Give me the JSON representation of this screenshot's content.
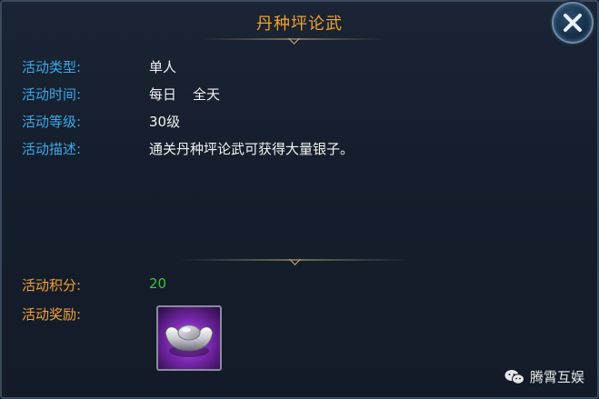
{
  "title": "丹种坪论武",
  "rows": {
    "type": {
      "label": "活动类型:",
      "value": "单人"
    },
    "time": {
      "label": "活动时间:",
      "value_a": "每日",
      "value_b": "全天"
    },
    "level": {
      "label": "活动等级:",
      "value": "30级"
    },
    "desc": {
      "label": "活动描述:",
      "value": "通关丹种坪论武可获得大量银子。"
    }
  },
  "score": {
    "label": "活动积分:",
    "value": "20"
  },
  "reward": {
    "label": "活动奖励:",
    "item_icon": "silver-ingot-icon"
  },
  "close_icon": "close-icon",
  "watermark": {
    "text": "腾霄互娱",
    "icon": "wechat-icon"
  },
  "colors": {
    "title": "#f0a030",
    "label_blue": "#3aa8e8",
    "label_orange": "#f0a030",
    "value": "#f2f2f2",
    "score": "#3ec03e",
    "reward_bg": "#7a28b0"
  }
}
